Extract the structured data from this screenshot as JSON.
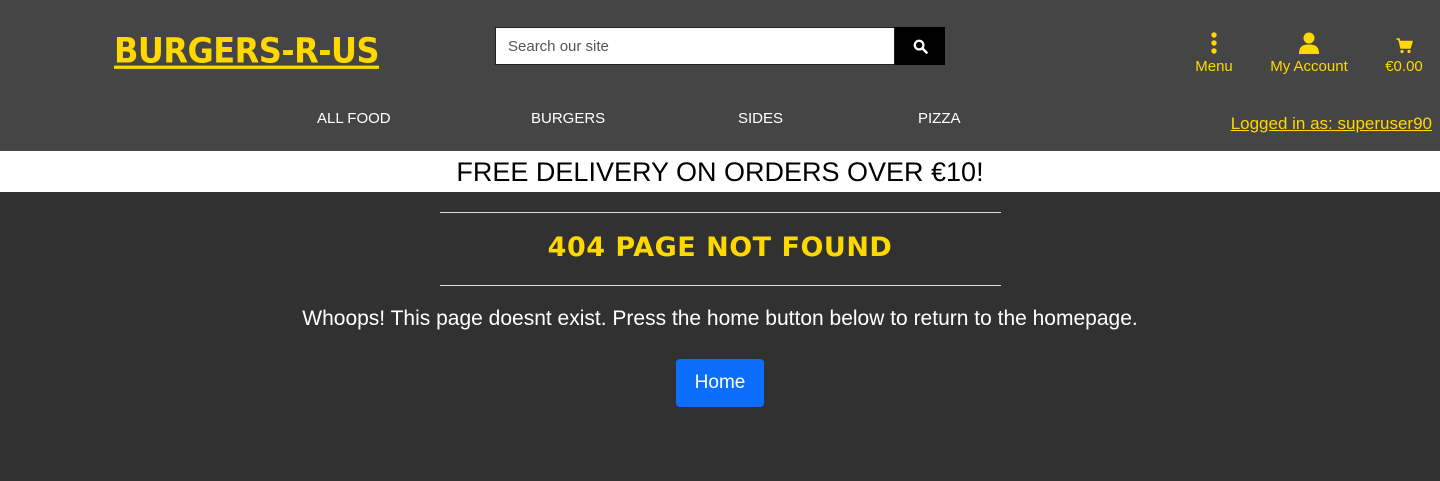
{
  "brand": {
    "name": "BURGERS-R-US"
  },
  "search": {
    "placeholder": "Search our site",
    "icon": "search-icon"
  },
  "header_links": [
    {
      "label": "Menu",
      "icon": "vertical-dots-icon"
    },
    {
      "label": "My Account",
      "icon": "user-icon"
    },
    {
      "label": "€0.00",
      "icon": "cart-icon"
    }
  ],
  "nav": [
    "ALL FOOD",
    "BURGERS",
    "SIDES",
    "PIZZA"
  ],
  "user": {
    "logged_in_label": "Logged in as: superuser90"
  },
  "banner": {
    "text": "FREE DELIVERY ON ORDERS OVER €10!"
  },
  "main": {
    "title": "404 PAGE NOT FOUND",
    "message": "Whoops! This page doesnt exist. Press the home button below to return to the homepage.",
    "button_label": "Home"
  },
  "colors": {
    "accent": "#ffd800",
    "header_bg": "#454545",
    "body_bg": "#313131",
    "button": "#0d6efd"
  }
}
